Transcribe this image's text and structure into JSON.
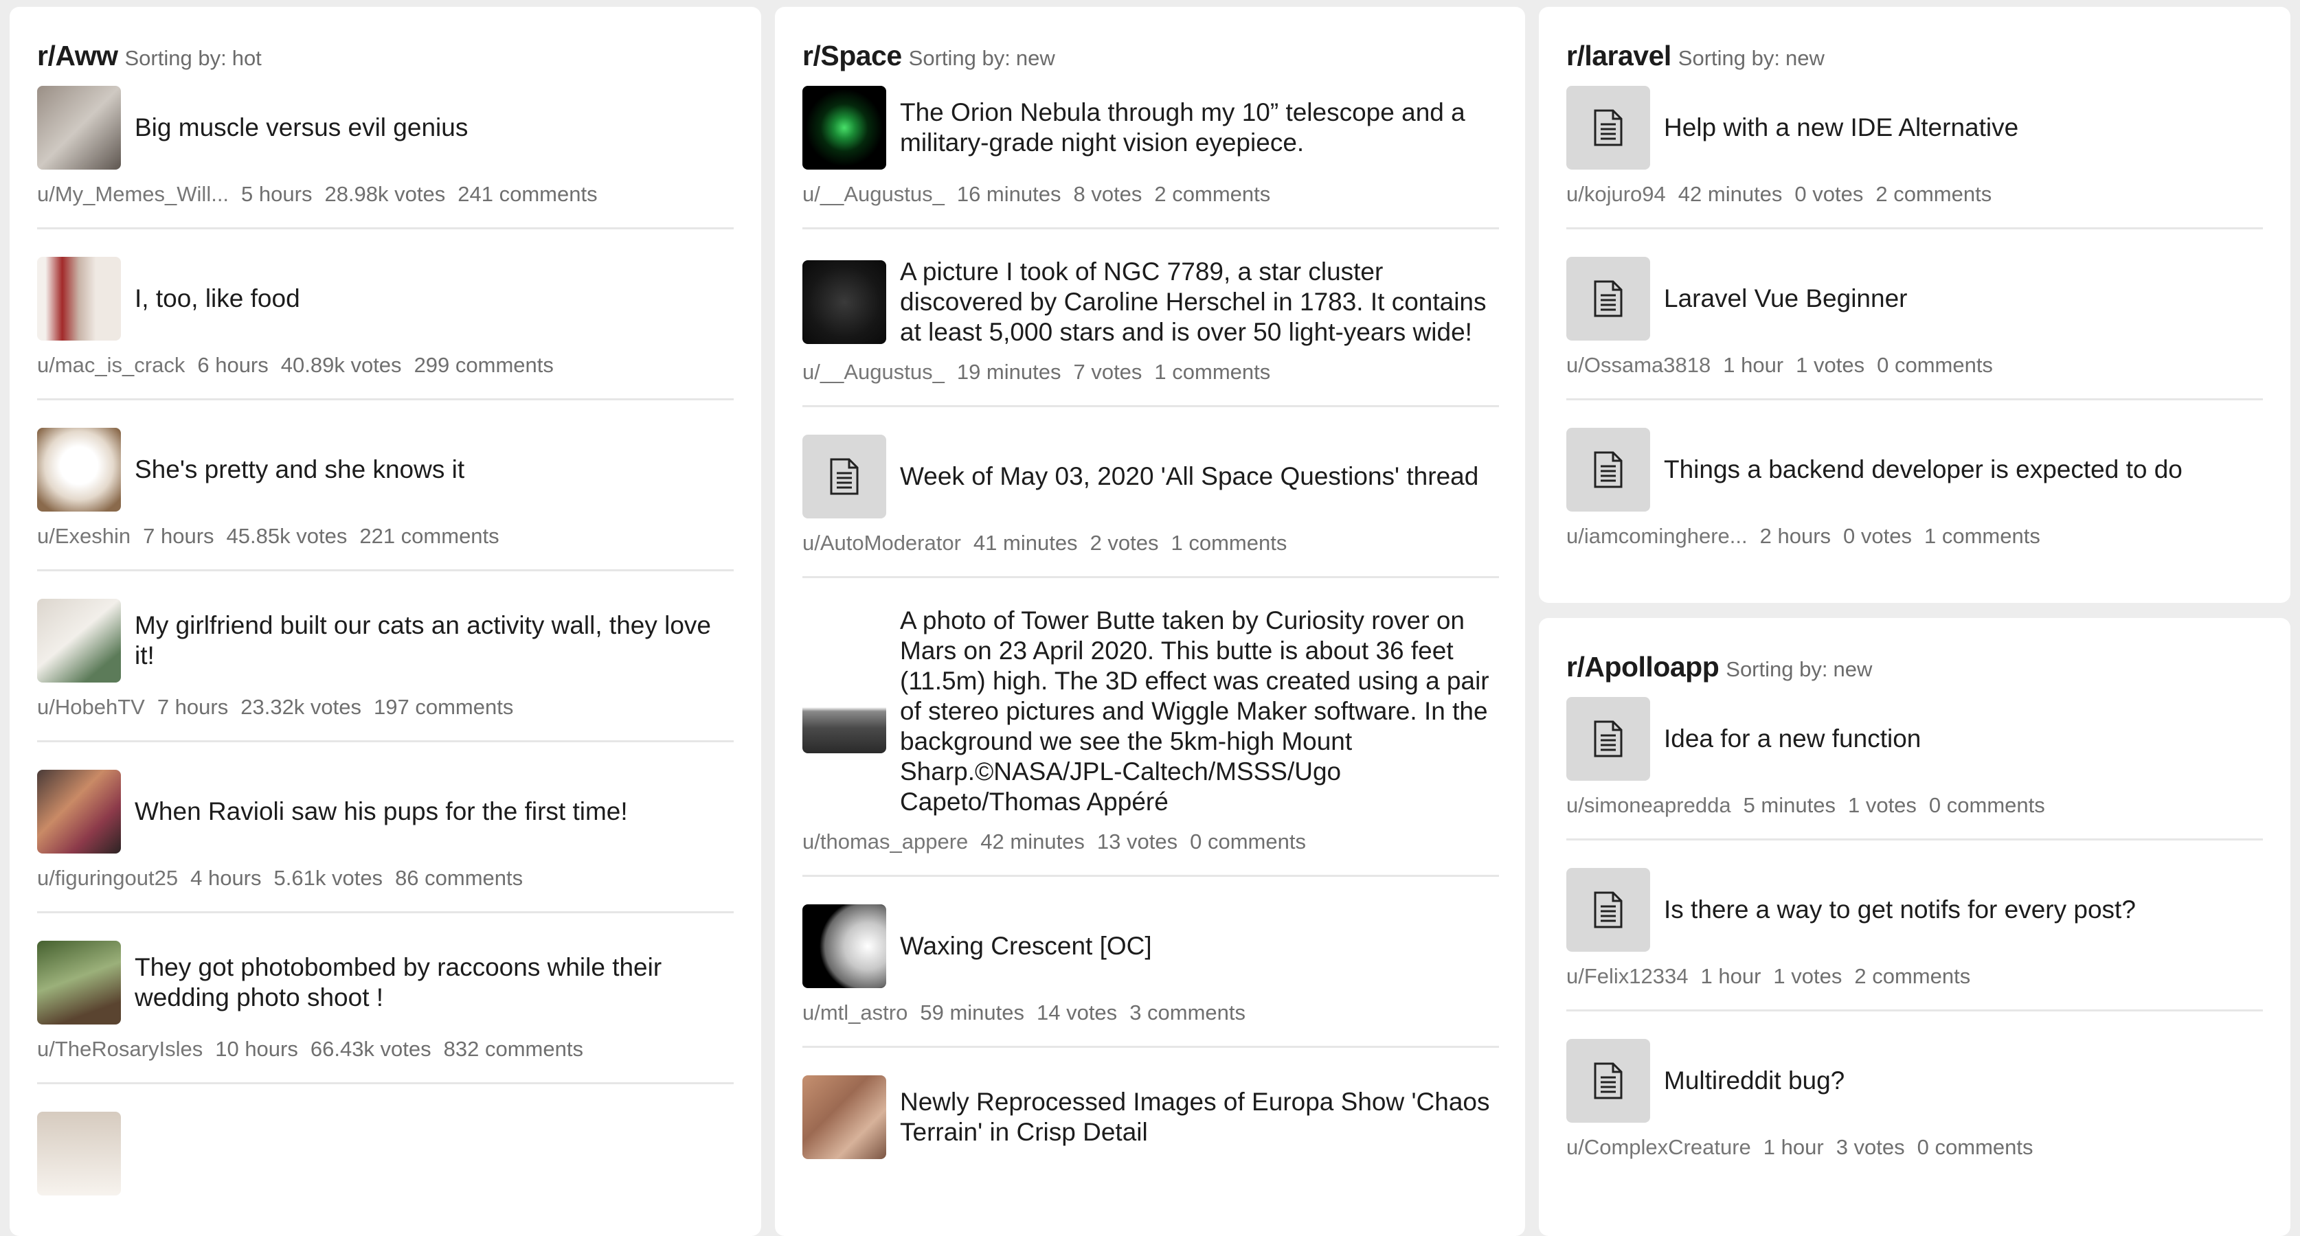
{
  "sorting_label": "Sorting by:",
  "columns": [
    {
      "subreddit": "r/Aww",
      "sort": "hot",
      "posts": [
        {
          "title": "Big muscle versus evil genius",
          "author": "u/My_Memes_Will...",
          "time": "5 hours",
          "votes": "28.98k votes",
          "comments": "241 comments"
        },
        {
          "title": "I, too, like food",
          "author": "u/mac_is_crack",
          "time": "6 hours",
          "votes": "40.89k votes",
          "comments": "299 comments"
        },
        {
          "title": "She's pretty and she knows it",
          "author": "u/Exeshin",
          "time": "7 hours",
          "votes": "45.85k votes",
          "comments": "221 comments"
        },
        {
          "title": "My girlfriend built our cats an activity wall, they love it!",
          "author": "u/HobehTV",
          "time": "7 hours",
          "votes": "23.32k votes",
          "comments": "197 comments"
        },
        {
          "title": "When Ravioli saw his pups for the first time!",
          "author": "u/figuringout25",
          "time": "4 hours",
          "votes": "5.61k votes",
          "comments": "86 comments"
        },
        {
          "title": "They got photobombed by raccoons while their wedding photo shoot !",
          "author": "u/TheRosaryIsles",
          "time": "10 hours",
          "votes": "66.43k votes",
          "comments": "832 comments"
        }
      ]
    },
    {
      "subreddit": "r/Space",
      "sort": "new",
      "posts": [
        {
          "title": "The Orion Nebula through my 10” telescope and a military-grade night vision eyepiece.",
          "author": "u/__Augustus_",
          "time": "16 minutes",
          "votes": "8 votes",
          "comments": "2 comments"
        },
        {
          "title": "A picture I took of NGC 7789, a star cluster discovered by Caroline Herschel in 1783. It contains at least 5,000 stars and is over 50 light-years wide!",
          "author": "u/__Augustus_",
          "time": "19 minutes",
          "votes": "7 votes",
          "comments": "1 comments"
        },
        {
          "title": "Week of May 03, 2020 'All Space Questions' thread",
          "author": "u/AutoModerator",
          "time": "41 minutes",
          "votes": "2 votes",
          "comments": "1 comments"
        },
        {
          "title": "A photo of Tower Butte taken by Curiosity rover on Mars on 23 April 2020. This butte is about 36 feet (11.5m) high. The 3D effect was created using a pair of stereo pictures and Wiggle Maker software. In the background we see the 5km-high Mount Sharp.©NASA/JPL-Caltech/MSSS/Ugo Capeto/Thomas Appéré",
          "author": "u/thomas_appere",
          "time": "42 minutes",
          "votes": "13 votes",
          "comments": "0 comments"
        },
        {
          "title": "Waxing Crescent [OC]",
          "author": "u/mtl_astro",
          "time": "59 minutes",
          "votes": "14 votes",
          "comments": "3 comments"
        },
        {
          "title": "Newly Reprocessed Images of Europa Show 'Chaos Terrain' in Crisp Detail",
          "author": "",
          "time": "",
          "votes": "",
          "comments": ""
        }
      ]
    },
    {
      "subreddit": "r/laravel",
      "sort": "new",
      "posts": [
        {
          "title": "Help with a new IDE Alternative",
          "author": "u/kojuro94",
          "time": "42 minutes",
          "votes": "0 votes",
          "comments": "2 comments"
        },
        {
          "title": "Laravel Vue Beginner",
          "author": "u/Ossama3818",
          "time": "1 hour",
          "votes": "1 votes",
          "comments": "0 comments"
        },
        {
          "title": "Things a backend developer is expected to do",
          "author": "u/iamcominghere...",
          "time": "2 hours",
          "votes": "0 votes",
          "comments": "1 comments"
        }
      ]
    },
    {
      "subreddit": "r/Apolloapp",
      "sort": "new",
      "posts": [
        {
          "title": "Idea for a new function",
          "author": "u/simoneapredda",
          "time": "5 minutes",
          "votes": "1 votes",
          "comments": "0 comments"
        },
        {
          "title": "Is there a way to get notifs for every post?",
          "author": "u/Felix12334",
          "time": "1 hour",
          "votes": "1 votes",
          "comments": "2 comments"
        },
        {
          "title": "Multireddit bug?",
          "author": "u/ComplexCreature",
          "time": "1 hour",
          "votes": "3 votes",
          "comments": "0 comments"
        }
      ]
    }
  ]
}
